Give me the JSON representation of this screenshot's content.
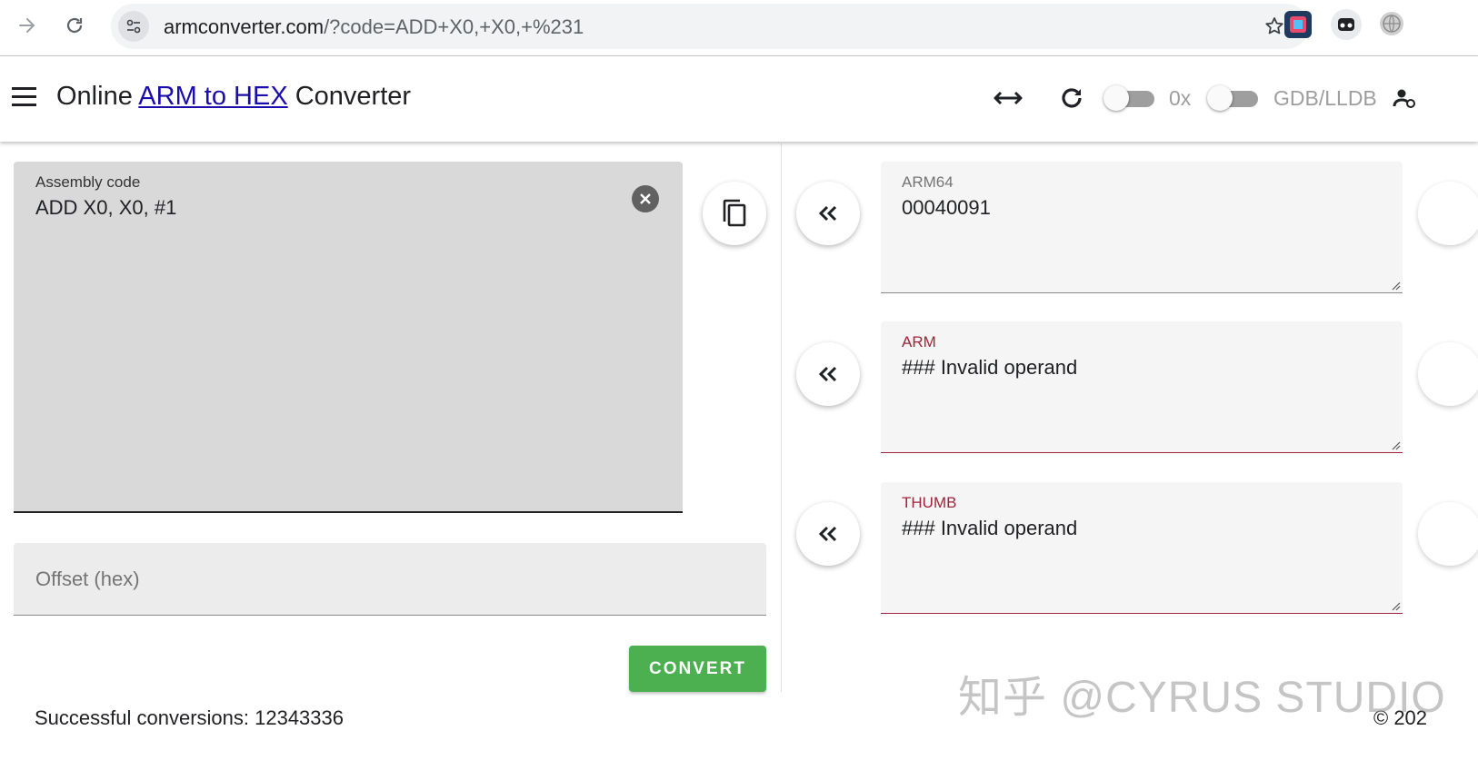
{
  "browser": {
    "url_host": "armconverter.com",
    "url_rest": "/?code=ADD+X0,+X0,+%231"
  },
  "header": {
    "title_prefix": "Online ",
    "title_link": "ARM to HEX",
    "title_suffix": " Converter",
    "hex_prefix_label": "0x",
    "debugger_label": "GDB/LLDB",
    "hex_prefix_enabled": false,
    "debugger_enabled": false
  },
  "assembly": {
    "label": "Assembly code",
    "value": "ADD X0, X0, #1"
  },
  "offset": {
    "placeholder": "Offset (hex)",
    "value": ""
  },
  "convert": {
    "label": "CONVERT"
  },
  "outputs": [
    {
      "label": "ARM64",
      "value": "00040091",
      "status": "ok"
    },
    {
      "label": "ARM",
      "value": "### Invalid operand",
      "status": "error"
    },
    {
      "label": "THUMB",
      "value": "### Invalid operand",
      "status": "error"
    }
  ],
  "footer": {
    "status_text": "Successful conversions: 12343336",
    "copyright": "© 202"
  },
  "watermark": "知乎 @CYRUS STUDIO",
  "colors": {
    "convert_button": "#4caf50",
    "error": "#a0243a",
    "link": "#1a0dab"
  }
}
